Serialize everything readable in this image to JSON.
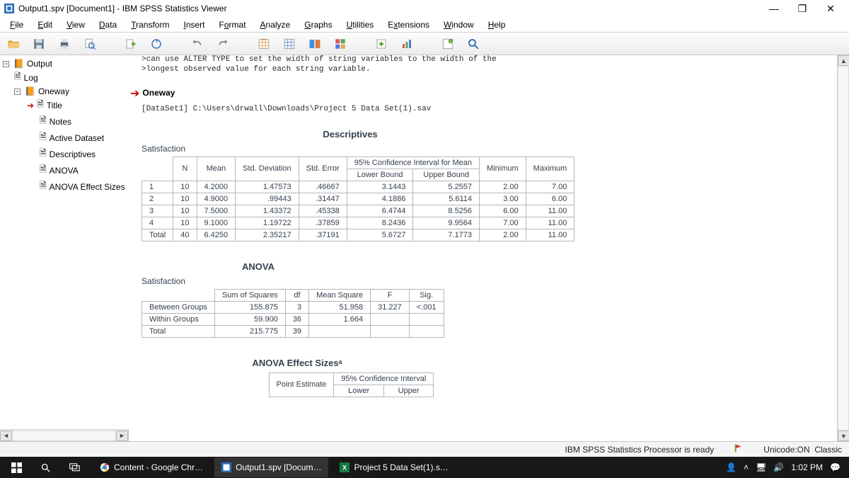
{
  "window": {
    "title": "Output1.spv [Document1] - IBM SPSS Statistics Viewer",
    "minimize": "—",
    "maximize": "❐",
    "close": "✕"
  },
  "menu": {
    "file": "File",
    "edit": "Edit",
    "view": "View",
    "data": "Data",
    "transform": "Transform",
    "insert": "Insert",
    "format": "Format",
    "analyze": "Analyze",
    "graphs": "Graphs",
    "utilities": "Utilities",
    "extensions": "Extensions",
    "window": "Window",
    "help": "Help"
  },
  "outline": {
    "root": "Output",
    "log": "Log",
    "oneway": "Oneway",
    "title": "Title",
    "notes": "Notes",
    "active_dataset": "Active Dataset",
    "descriptives": "Descriptives",
    "anova": "ANOVA",
    "effect_sizes": "ANOVA Effect Sizes"
  },
  "content": {
    "syntax_line1": ">can use ALTER TYPE to set the width of string variables to the width of the",
    "syntax_line2": ">longest observed value for each string variable.",
    "section_head": "Oneway",
    "dataset": "[DataSet1] C:\\Users\\drwall\\Downloads\\Project 5 Data Set(1).sav",
    "descriptives_title": "Descriptives",
    "descriptives_caption": "Satisfaction",
    "anova_title": "ANOVA",
    "anova_caption": "Satisfaction",
    "effect_title": "ANOVA Effect Sizesᵃ"
  },
  "desc_head": {
    "n": "N",
    "mean": "Mean",
    "std_dev": "Std. Deviation",
    "std_err": "Std. Error",
    "ci": "95% Confidence Interval for Mean",
    "lower": "Lower Bound",
    "upper": "Upper Bound",
    "min": "Minimum",
    "max": "Maximum"
  },
  "desc_rows": [
    {
      "label": "1",
      "n": "10",
      "mean": "4.2000",
      "sd": "1.47573",
      "se": ".46667",
      "lb": "3.1443",
      "ub": "5.2557",
      "min": "2.00",
      "max": "7.00"
    },
    {
      "label": "2",
      "n": "10",
      "mean": "4.9000",
      "sd": ".99443",
      "se": ".31447",
      "lb": "4.1886",
      "ub": "5.6114",
      "min": "3.00",
      "max": "6.00"
    },
    {
      "label": "3",
      "n": "10",
      "mean": "7.5000",
      "sd": "1.43372",
      "se": ".45338",
      "lb": "6.4744",
      "ub": "8.5256",
      "min": "6.00",
      "max": "11.00"
    },
    {
      "label": "4",
      "n": "10",
      "mean": "9.1000",
      "sd": "1.19722",
      "se": ".37859",
      "lb": "8.2436",
      "ub": "9.9564",
      "min": "7.00",
      "max": "11.00"
    },
    {
      "label": "Total",
      "n": "40",
      "mean": "6.4250",
      "sd": "2.35217",
      "se": ".37191",
      "lb": "5.6727",
      "ub": "7.1773",
      "min": "2.00",
      "max": "11.00"
    }
  ],
  "anova_head": {
    "ss": "Sum of Squares",
    "df": "df",
    "ms": "Mean Square",
    "f": "F",
    "sig": "Sig."
  },
  "anova_rows": [
    {
      "label": "Between Groups",
      "ss": "155.875",
      "df": "3",
      "ms": "51.958",
      "f": "31.227",
      "sig": "<.001"
    },
    {
      "label": "Within Groups",
      "ss": "59.900",
      "df": "36",
      "ms": "1.664",
      "f": "",
      "sig": ""
    },
    {
      "label": "Total",
      "ss": "215.775",
      "df": "39",
      "ms": "",
      "f": "",
      "sig": ""
    }
  ],
  "effect_head": {
    "pe": "Point Estimate",
    "ci": "95% Confidence Interval",
    "lower": "Lower",
    "upper": "Upper"
  },
  "status": {
    "processor": "IBM SPSS Statistics Processor is ready",
    "unicode": "Unicode:ON",
    "mode": "Classic"
  },
  "taskbar": {
    "chrome": "Content - Google Chr…",
    "spss": "Output1.spv [Docum…",
    "excel": "Project 5 Data Set(1).s…",
    "time": "1:02 PM"
  }
}
